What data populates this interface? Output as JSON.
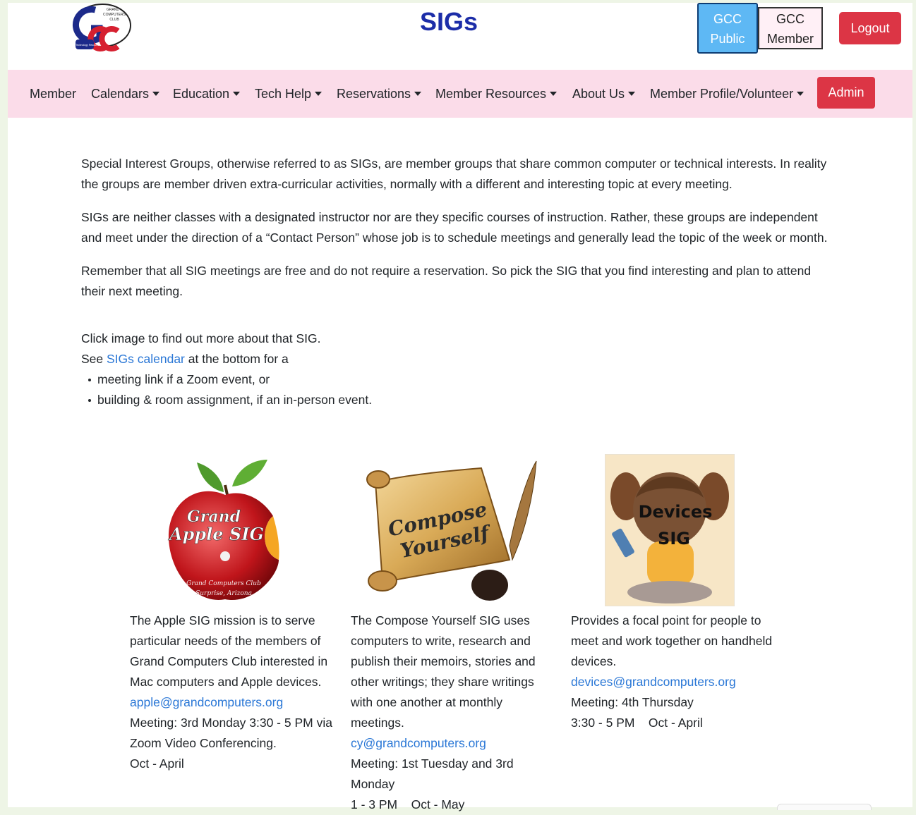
{
  "header": {
    "logo_text": [
      "GRAND",
      "COMPUTERS",
      "CLUB",
      "Your Technology Resource"
    ],
    "title": "SIGs",
    "public_line1": "GCC",
    "public_line2": "Public",
    "member_line1": "GCC",
    "member_line2": "Member",
    "logout": "Logout"
  },
  "nav": {
    "items": [
      "Member",
      "Calendars",
      "Education",
      "Tech Help",
      "Reservations",
      "Member Resources",
      "About Us",
      "Member Profile/Volunteer"
    ],
    "admin": "Admin"
  },
  "intro": {
    "p1": "Special Interest Groups, otherwise referred to as SIGs, are member groups that share common computer or technical interests. In reality the groups are member driven extra-curricular activities, normally with a different and interesting topic at every meeting.",
    "p2": "SIGs are neither classes with a designated instructor nor are they specific courses of instruction. Rather, these groups are independent and meet under the direction of a “Contact Person” whose job is to schedule meetings and generally lead the topic of the week or month.",
    "p3": "Remember that all SIG meetings are free and do not require a reservation. So pick the SIG that you find interesting and plan to attend their next meeting.",
    "click_line": "Click image to find out more about that SIG.",
    "see_prefix": "See ",
    "see_link": "SIGs calendar",
    "see_suffix": " at the bottom for a",
    "bullets": [
      "meeting link if a Zoom event, or",
      "building & room assignment, if an in-person event."
    ]
  },
  "cards": [
    {
      "image_label_1": "Grand",
      "image_label_2": "Apple SIG",
      "image_caption_1": "Grand Computers Club",
      "image_caption_2": "Surprise, Arizona",
      "description": "The Apple SIG mission is to serve particular needs of the members of Grand Computers Club interested in Mac computers and Apple devices.",
      "email": "apple@grandcomputers.org",
      "meeting": "Meeting: 3rd Monday 3:30 - 5 PM via Zoom Video Conferencing.",
      "season": "Oct - April"
    },
    {
      "image_label_1": "Compose",
      "image_label_2": "Yourself",
      "description": "The Compose Yourself SIG uses computers to write, research and publish their memoirs, stories and other writings; they share writings with one another at monthly meetings.",
      "email": "cy@grandcomputers.org",
      "meeting": "Meeting: 1st Tuesday and 3rd Monday",
      "season": "1 - 3 PM    Oct - May"
    },
    {
      "image_label_1": "Devices",
      "image_label_2": "SIG",
      "description": "Provides a focal point for people to meet and work together on handheld devices.",
      "email": "devices@grandcomputers.org",
      "meeting": "Meeting: 4th Thursday",
      "season": "3:30 - 5 PM    Oct - April"
    }
  ],
  "colors": {
    "title": "#1c2da8",
    "nav_bg": "#fbdce9",
    "danger": "#dc3545",
    "link": "#2a77d6",
    "public_btn": "#5eb8f4"
  }
}
